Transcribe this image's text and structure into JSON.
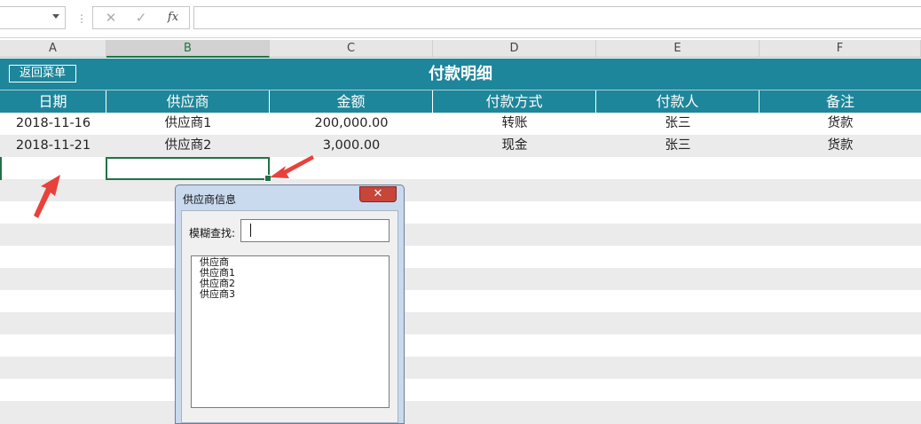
{
  "formula_bar": {
    "name_box": "",
    "cancel_icon": "✕",
    "enter_icon": "✓",
    "fx_label": "fx",
    "formula": ""
  },
  "columns": [
    "A",
    "B",
    "C",
    "D",
    "E",
    "F"
  ],
  "title_band": {
    "menu_button": "返回菜单",
    "title": "付款明细",
    "color": "#1e869a"
  },
  "table": {
    "headers": [
      "日期",
      "供应商",
      "金额",
      "付款方式",
      "付款人",
      "备注"
    ],
    "rows": [
      [
        "2018-11-16",
        "供应商1",
        "200,000.00",
        "转账",
        "张三",
        "货款"
      ],
      [
        "2018-11-21",
        "供应商2",
        "3,000.00",
        "现金",
        "张三",
        "货款"
      ]
    ]
  },
  "dialog": {
    "title": "供应商信息",
    "close_icon": "✕",
    "search_label": "模糊查找:",
    "search_value": "",
    "list_items": [
      "供应商",
      "供应商1",
      "供应商2",
      "供应商3"
    ]
  },
  "accent_color": "#217346",
  "annotation_color": "#e8413c"
}
